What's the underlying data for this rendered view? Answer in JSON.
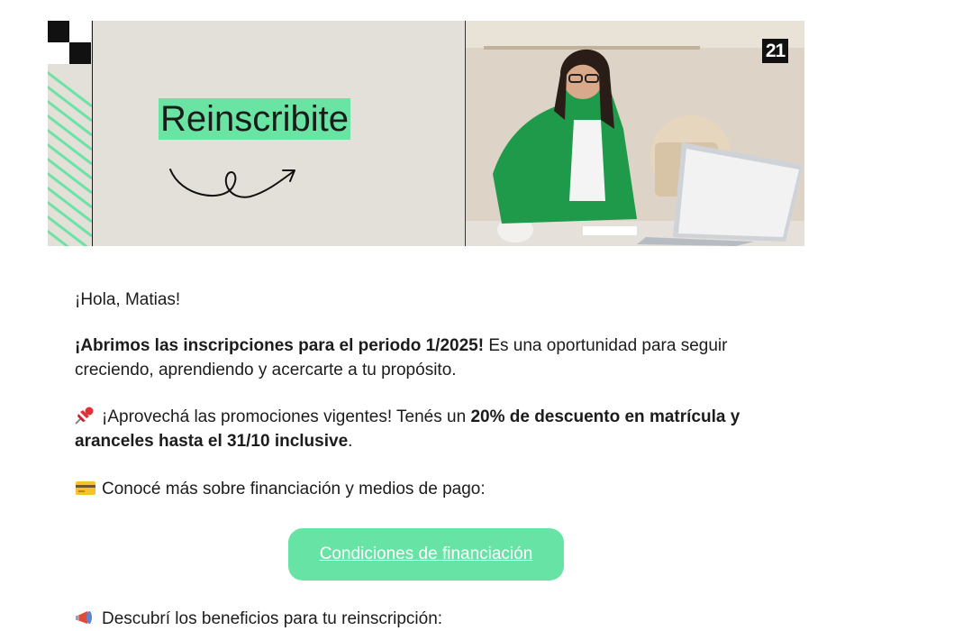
{
  "banner": {
    "title": "Reinscribite",
    "logo_text": "21",
    "colors": {
      "accent": "#6ae4a3",
      "background": "#e3e0d9"
    },
    "photo": "woman-writing-at-laptop"
  },
  "email": {
    "greeting": "¡Hola, Matias!",
    "intro_bold": "¡Abrimos las inscripciones para el periodo 1/2025!",
    "intro_rest": " Es una oportunidad para seguir creciendo, aprendiendo y acercarte a tu propósito.",
    "promo_icon": "pushpin-icon",
    "promo_text": "¡Aprovechá las promociones vigentes! Tenés un ",
    "promo_bold": "20% de descuento en matrícula y aranceles hasta el 31/10 inclusive",
    "promo_end": ".",
    "financing_icon": "credit-card-icon",
    "financing_text": "Conocé más sobre financiación y medios de pago:",
    "cta_label": "Condiciones de financiación",
    "benefits_icon": "megaphone-icon",
    "benefits_text": "Descubrí los beneficios para tu reinscripción:"
  }
}
